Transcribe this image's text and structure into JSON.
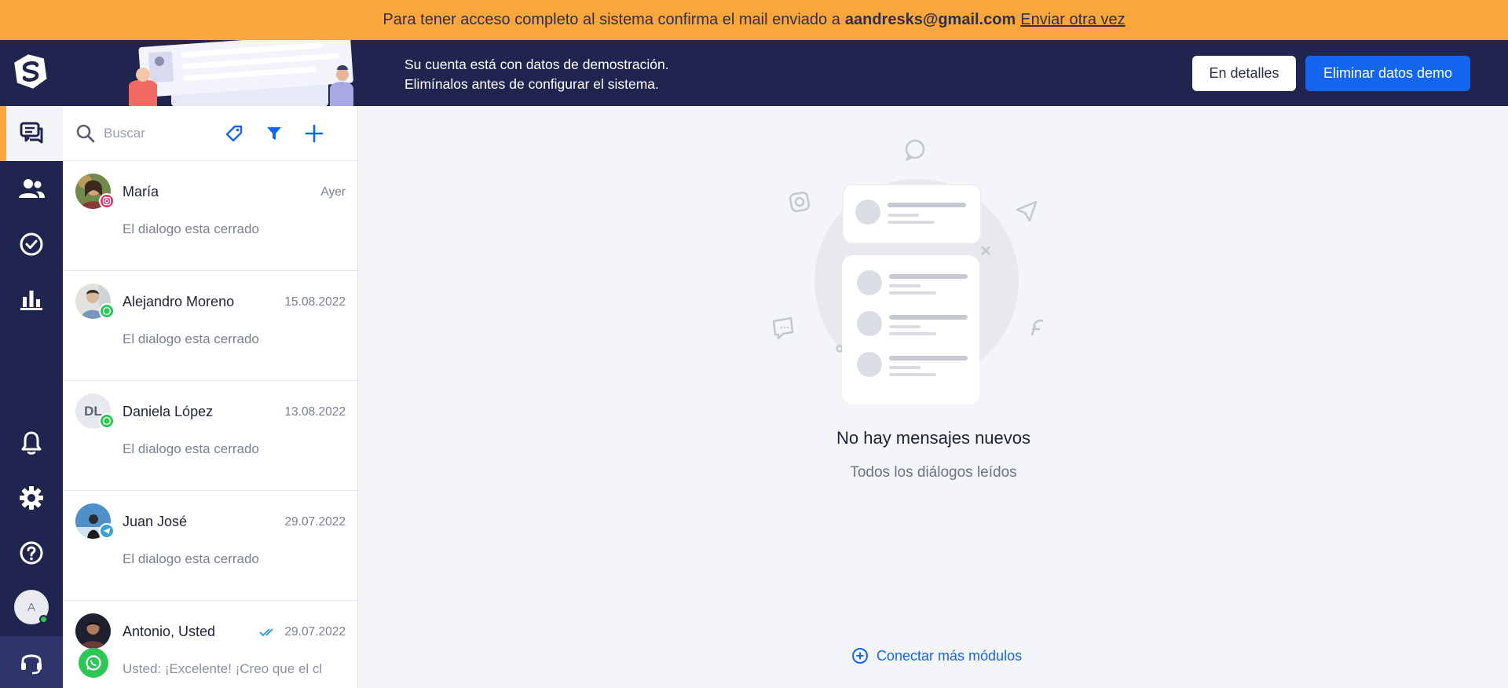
{
  "banner": {
    "text": "Para tener acceso completo al sistema confirma el mail enviado a",
    "email": "aandresks@gmail.com",
    "resend": "Enviar otra vez"
  },
  "demo": {
    "line1": "Su cuenta está con datos de demostración.",
    "line2": "Elimínalos antes de configurar el sistema.",
    "details_btn": "En detalles",
    "delete_btn": "Eliminar datos demo"
  },
  "rail": {
    "avatar_letter": "A",
    "icons": [
      "chats-icon",
      "contacts-icon",
      "tasks-icon",
      "analytics-icon",
      "bell-icon",
      "gear-icon",
      "help-icon",
      "headset-icon"
    ]
  },
  "search": {
    "placeholder": "Buscar"
  },
  "conversations": [
    {
      "name": "María",
      "date": "Ayer",
      "preview": "El dialogo esta cerrado",
      "channel": "instagram"
    },
    {
      "name": "Alejandro Moreno",
      "date": "15.08.2022",
      "preview": "El dialogo esta cerrado",
      "channel": "whatsapp"
    },
    {
      "name": "Daniela López",
      "date": "13.08.2022",
      "preview": "El dialogo esta cerrado",
      "channel": "whatsapp",
      "initials": "DL"
    },
    {
      "name": "Juan José",
      "date": "29.07.2022",
      "preview": "El dialogo esta cerrado",
      "channel": "telegram"
    },
    {
      "name": "Antonio, Usted",
      "date": "29.07.2022",
      "preview": "Usted: ¡Excelente! ¡Creo que el cl",
      "channel": "whatsapp"
    }
  ],
  "empty": {
    "title": "No hay mensajes nuevos",
    "subtitle": "Todos los diálogos leídos"
  },
  "connect": "Conectar más módulos",
  "colors": {
    "banner": "#fba63c",
    "navy": "#20254f",
    "accent": "#1466f0",
    "whatsapp": "#2ec655",
    "instagram": "#e1306c",
    "telegram": "#3aa0d8"
  }
}
